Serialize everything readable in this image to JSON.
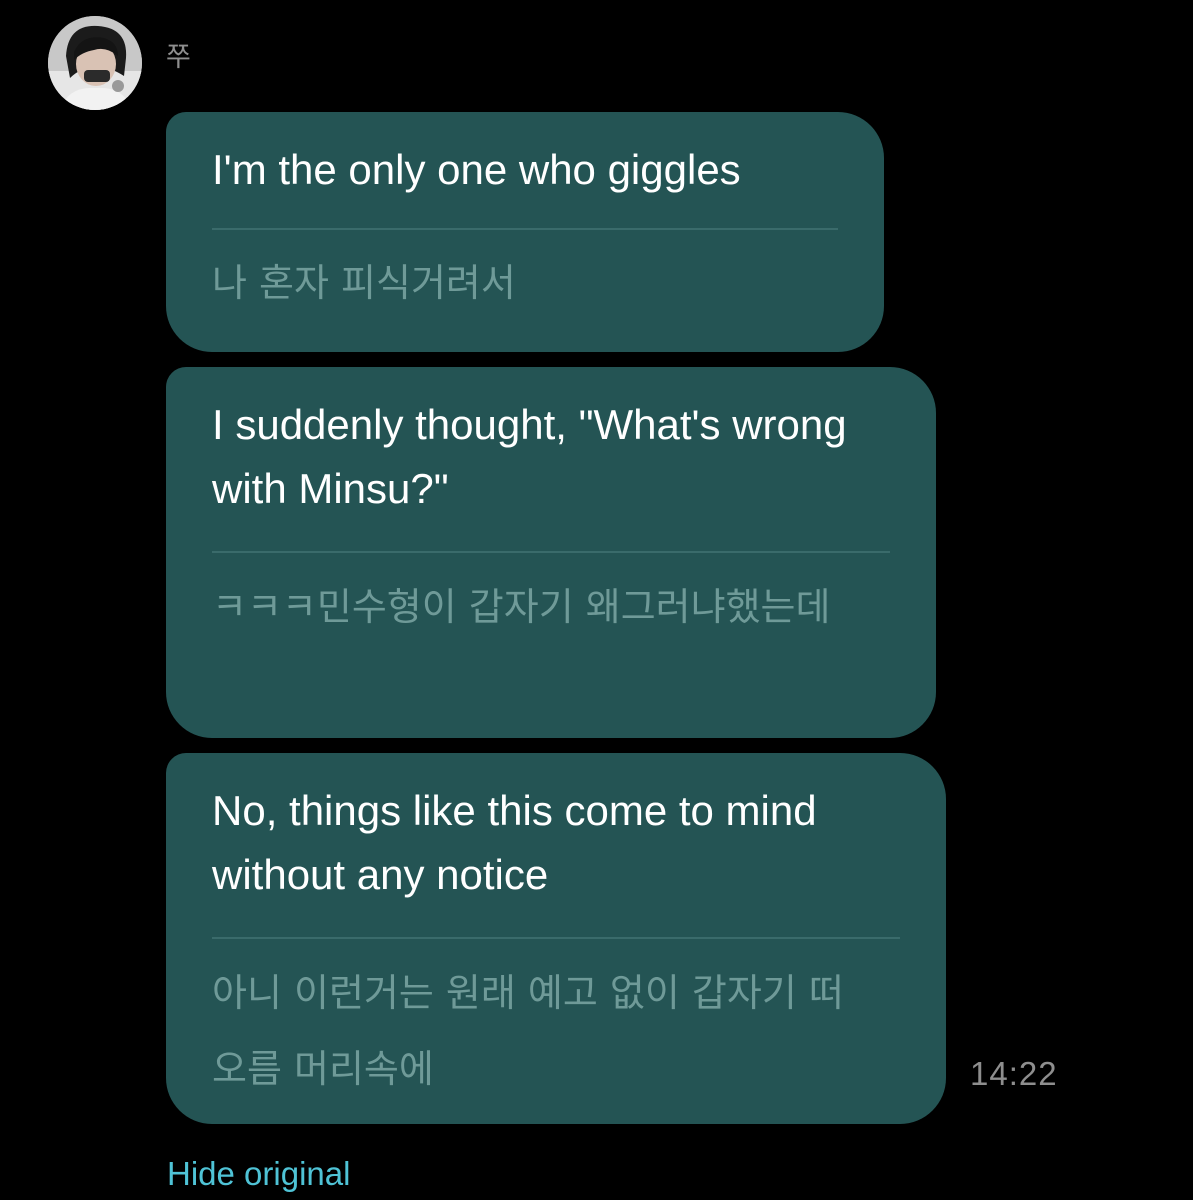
{
  "sender": {
    "name": "쭈"
  },
  "messages": [
    {
      "translated": "I'm the only one who giggles",
      "original": "나 혼자 피식거려서"
    },
    {
      "translated": "I suddenly thought, \"What's wrong with Minsu?\"",
      "original": "ㅋㅋㅋ민수형이 갑자기 왜그러냐했는데"
    },
    {
      "translated": "No, things like this come to mind without any notice",
      "original": "아니 이런거는 원래 예고 없이 갑자기 떠오름 머리속에"
    }
  ],
  "timestamp": "14:22",
  "hide_original_label": "Hide original",
  "colors": {
    "background": "#000000",
    "bubble": "#245454",
    "translated_text": "#ffffff",
    "original_text": "#6f9a98",
    "link": "#4fc3d6"
  }
}
